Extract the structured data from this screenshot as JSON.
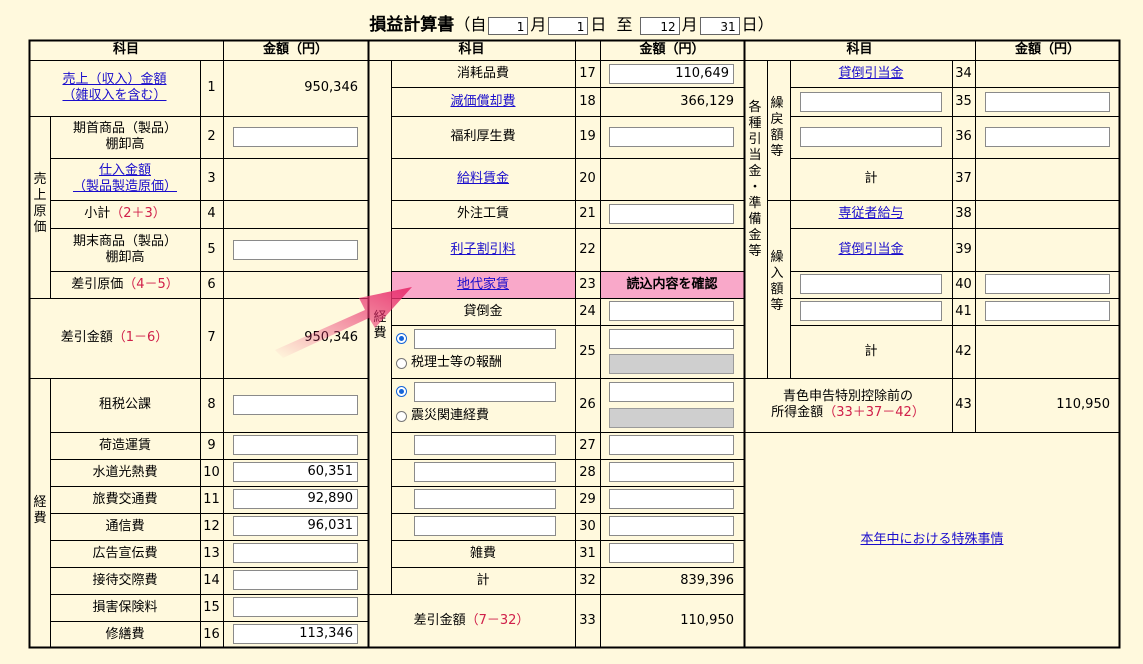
{
  "title": {
    "name": "損益計算書",
    "from": "（自",
    "month_unit": "月",
    "day_unit": "日",
    "to": "至",
    "close": "）",
    "from_month": "1",
    "from_day": "1",
    "to_month": "12",
    "to_day": "31"
  },
  "headers": {
    "item": "科目",
    "amount": "金額（円）"
  },
  "groups": {
    "sales_cost": "売上原価",
    "expenses_left": "経費",
    "expenses_mid": "経費",
    "reserves_in": "繰戻額等",
    "reserves_all": "各種引当金・準備金等",
    "reserves_out": "繰入額等"
  },
  "rows": {
    "r1": {
      "label": "売上（収入）金額（雑収入を含む）",
      "label_l1": "売上（収入）金額",
      "label_l2": "（雑収入を含む）",
      "no": "1",
      "amount": "950,346"
    },
    "r2": {
      "label_l1": "期首商品（製品）",
      "label_l2": "棚卸高",
      "no": "2",
      "amount": ""
    },
    "r3": {
      "label_l1": "仕入金額",
      "label_l2": "（製品製造原価）",
      "no": "3"
    },
    "r4": {
      "label": "小計",
      "formula": "（2＋3）",
      "no": "4"
    },
    "r5": {
      "label_l1": "期末商品（製品）",
      "label_l2": "棚卸高",
      "no": "5",
      "amount": ""
    },
    "r6": {
      "label": "差引原価",
      "formula": "（4－5）",
      "no": "6"
    },
    "r7": {
      "label": "差引金額",
      "formula": "（1－6）",
      "no": "7",
      "amount": "950,346"
    },
    "r8": {
      "label": "租税公課",
      "no": "8",
      "amount": ""
    },
    "r9": {
      "label": "荷造運賃",
      "no": "9",
      "amount": ""
    },
    "r10": {
      "label": "水道光熱費",
      "no": "10",
      "amount": "60,351"
    },
    "r11": {
      "label": "旅費交通費",
      "no": "11",
      "amount": "92,890"
    },
    "r12": {
      "label": "通信費",
      "no": "12",
      "amount": "96,031"
    },
    "r13": {
      "label": "広告宣伝費",
      "no": "13",
      "amount": ""
    },
    "r14": {
      "label": "接待交際費",
      "no": "14",
      "amount": ""
    },
    "r15": {
      "label": "損害保険料",
      "no": "15",
      "amount": ""
    },
    "r16": {
      "label": "修繕費",
      "no": "16",
      "amount": "113,346"
    },
    "r17": {
      "label": "消耗品費",
      "no": "17",
      "amount": "110,649"
    },
    "r18": {
      "label": "減価償却費",
      "no": "18",
      "amount": "366,129"
    },
    "r19": {
      "label": "福利厚生費",
      "no": "19",
      "amount": ""
    },
    "r20": {
      "label": "給料賃金",
      "no": "20"
    },
    "r21": {
      "label": "外注工賃",
      "no": "21",
      "amount": ""
    },
    "r22": {
      "label": "利子割引料",
      "no": "22"
    },
    "r23": {
      "label": "地代家賃",
      "no": "23",
      "action": "読込内容を確認"
    },
    "r24": {
      "label": "貸倒金",
      "no": "24",
      "amount": ""
    },
    "r25": {
      "option": "税理士等の報酬",
      "no": "25",
      "amount": ""
    },
    "r26": {
      "option": "震災関連経費",
      "no": "26",
      "amount": ""
    },
    "r27": {
      "no": "27"
    },
    "r28": {
      "no": "28"
    },
    "r29": {
      "no": "29"
    },
    "r30": {
      "no": "30"
    },
    "r31": {
      "label": "雑費",
      "no": "31",
      "amount": ""
    },
    "r32": {
      "label": "計",
      "no": "32",
      "amount": "839,396"
    },
    "r33": {
      "label": "差引金額",
      "formula": "（7－32）",
      "no": "33",
      "amount": "110,950"
    },
    "r34": {
      "label": "貸倒引当金",
      "no": "34"
    },
    "r35": {
      "no": "35"
    },
    "r36": {
      "no": "36"
    },
    "r37": {
      "label": "計",
      "no": "37"
    },
    "r38": {
      "label": "専従者給与",
      "no": "38"
    },
    "r39": {
      "label": "貸倒引当金",
      "no": "39"
    },
    "r40": {
      "no": "40"
    },
    "r41": {
      "no": "41"
    },
    "r42": {
      "label": "計",
      "no": "42"
    },
    "r43": {
      "label_l1": "青色申告特別控除前の",
      "label_l2": "所得金額",
      "formula": "（33＋37－42）",
      "no": "43",
      "amount": "110,950"
    }
  },
  "special": {
    "label": "本年中における特殊事情"
  },
  "colors": {
    "background": "#fff9dd",
    "link": "#1a0dcc",
    "formula": "#d0204a",
    "highlight": "#f9a8c9",
    "arrow": "#e8306e"
  }
}
